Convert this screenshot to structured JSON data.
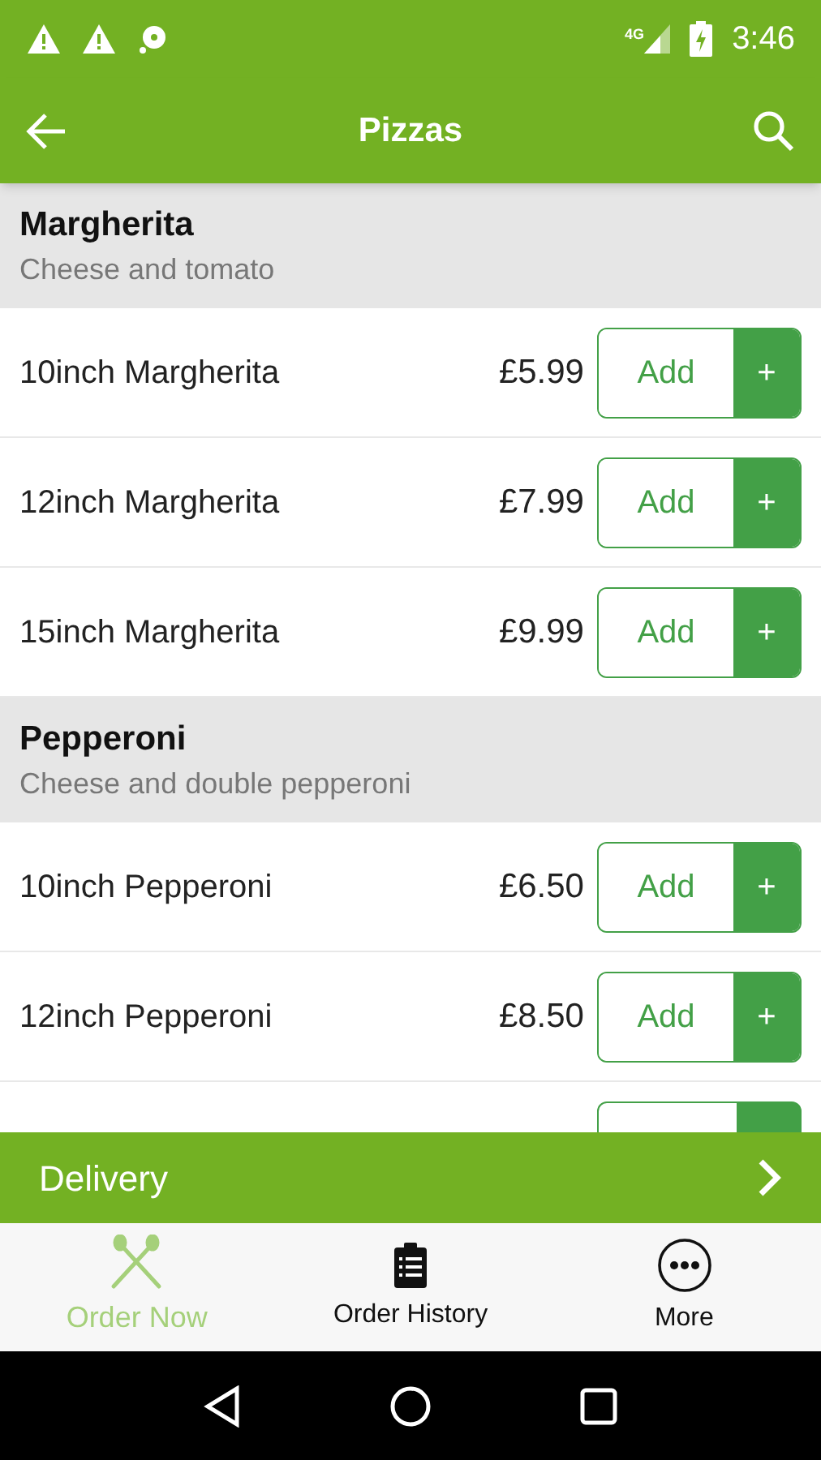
{
  "status_bar": {
    "network": "4G",
    "time": "3:46"
  },
  "app_bar": {
    "title": "Pizzas"
  },
  "sections": [
    {
      "name": "Margherita",
      "description": "Cheese and tomato",
      "items": [
        {
          "name": "10inch Margherita",
          "price": "£5.99",
          "button": "Add",
          "plus": "+"
        },
        {
          "name": "12inch Margherita",
          "price": "£7.99",
          "button": "Add",
          "plus": "+"
        },
        {
          "name": "15inch Margherita",
          "price": "£9.99",
          "button": "Add",
          "plus": "+"
        }
      ]
    },
    {
      "name": "Pepperoni",
      "description": "Cheese and double pepperoni",
      "items": [
        {
          "name": "10inch Pepperoni",
          "price": "£6.50",
          "button": "Add",
          "plus": "+"
        },
        {
          "name": "12inch Pepperoni",
          "price": "£8.50",
          "button": "Add",
          "plus": "+"
        }
      ]
    }
  ],
  "delivery_bar": {
    "label": "Delivery"
  },
  "bottom_nav": [
    {
      "label": "Order Now",
      "kind": "cutlery",
      "selected": true
    },
    {
      "label": "Order History",
      "kind": "clipboard",
      "selected": false
    },
    {
      "label": "More",
      "kind": "more",
      "selected": false
    }
  ]
}
